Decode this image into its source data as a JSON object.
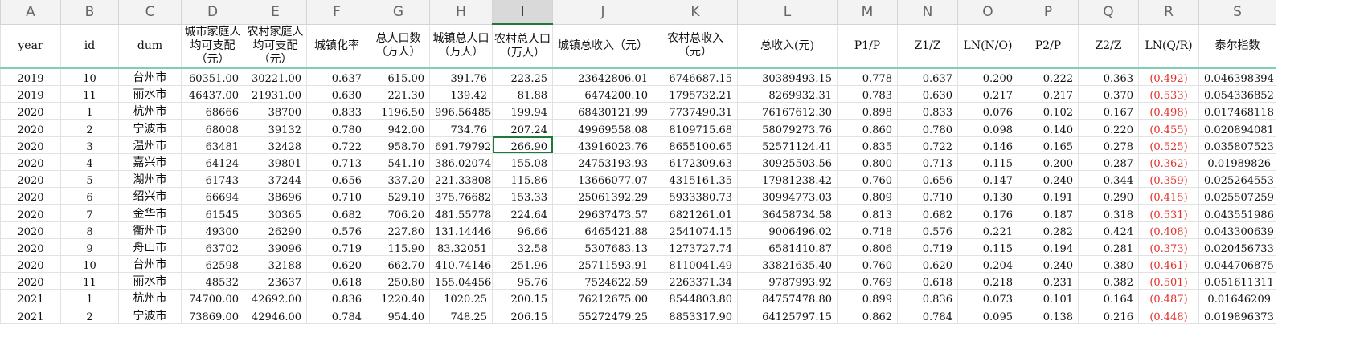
{
  "columns": [
    "A",
    "B",
    "C",
    "D",
    "E",
    "F",
    "G",
    "H",
    "I",
    "J",
    "K",
    "L",
    "M",
    "N",
    "O",
    "P",
    "Q",
    "R",
    "S"
  ],
  "selected_column": "I",
  "headers": [
    "year",
    "id",
    "dum",
    "城市家庭人均可支配（元）",
    "农村家庭人均可支配（元）",
    "城镇化率",
    "总人口数（万人）",
    "城镇总人口（万人）",
    "农村总人口（万人）",
    "城镇总收入（元）",
    "农村总收入（元）",
    "总收入(元)",
    "P1/P",
    "Z1/Z",
    "LN(N/O)",
    "P2/P",
    "Z2/Z",
    "LN(Q/R)",
    "泰尔指数"
  ],
  "rows": [
    [
      "2019",
      "10",
      "台州市",
      "60351.00",
      "30221.00",
      "0.637",
      "615.00",
      "391.76",
      "223.25",
      "23642806.01",
      "6746687.15",
      "30389493.15",
      "0.778",
      "0.637",
      "0.200",
      "0.222",
      "0.363",
      "(0.492)",
      "0.046398394"
    ],
    [
      "2019",
      "11",
      "丽水市",
      "46437.00",
      "21931.00",
      "0.630",
      "221.30",
      "139.42",
      "81.88",
      "6474200.10",
      "1795732.21",
      "8269932.31",
      "0.783",
      "0.630",
      "0.217",
      "0.217",
      "0.370",
      "(0.533)",
      "0.054336852"
    ],
    [
      "2020",
      "1",
      "杭州市",
      "68666",
      "38700",
      "0.833",
      "1196.50",
      "996.56485",
      "199.94",
      "68430121.99",
      "7737490.31",
      "76167612.30",
      "0.898",
      "0.833",
      "0.076",
      "0.102",
      "0.167",
      "(0.498)",
      "0.017468118"
    ],
    [
      "2020",
      "2",
      "宁波市",
      "68008",
      "39132",
      "0.780",
      "942.00",
      "734.76",
      "207.24",
      "49969558.08",
      "8109715.68",
      "58079273.76",
      "0.860",
      "0.780",
      "0.098",
      "0.140",
      "0.220",
      "(0.455)",
      "0.020894081"
    ],
    [
      "2020",
      "3",
      "温州市",
      "63481",
      "32428",
      "0.722",
      "958.70",
      "691.79792",
      "266.90",
      "43916023.76",
      "8655100.65",
      "52571124.41",
      "0.835",
      "0.722",
      "0.146",
      "0.165",
      "0.278",
      "(0.525)",
      "0.035807523"
    ],
    [
      "2020",
      "4",
      "嘉兴市",
      "64124",
      "39801",
      "0.713",
      "541.10",
      "386.02074",
      "155.08",
      "24753193.93",
      "6172309.63",
      "30925503.56",
      "0.800",
      "0.713",
      "0.115",
      "0.200",
      "0.287",
      "(0.362)",
      "0.01989826"
    ],
    [
      "2020",
      "5",
      "湖州市",
      "61743",
      "37244",
      "0.656",
      "337.20",
      "221.33808",
      "115.86",
      "13666077.07",
      "4315161.35",
      "17981238.42",
      "0.760",
      "0.656",
      "0.147",
      "0.240",
      "0.344",
      "(0.359)",
      "0.025264553"
    ],
    [
      "2020",
      "6",
      "绍兴市",
      "66694",
      "38696",
      "0.710",
      "529.10",
      "375.76682",
      "153.33",
      "25061392.29",
      "5933380.73",
      "30994773.03",
      "0.809",
      "0.710",
      "0.130",
      "0.191",
      "0.290",
      "(0.415)",
      "0.025507259"
    ],
    [
      "2020",
      "7",
      "金华市",
      "61545",
      "30365",
      "0.682",
      "706.20",
      "481.55778",
      "224.64",
      "29637473.57",
      "6821261.01",
      "36458734.58",
      "0.813",
      "0.682",
      "0.176",
      "0.187",
      "0.318",
      "(0.531)",
      "0.043551986"
    ],
    [
      "2020",
      "8",
      "衢州市",
      "49300",
      "26290",
      "0.576",
      "227.80",
      "131.14446",
      "96.66",
      "6465421.88",
      "2541074.15",
      "9006496.02",
      "0.718",
      "0.576",
      "0.221",
      "0.282",
      "0.424",
      "(0.408)",
      "0.043300639"
    ],
    [
      "2020",
      "9",
      "舟山市",
      "63702",
      "39096",
      "0.719",
      "115.90",
      "83.32051",
      "32.58",
      "5307683.13",
      "1273727.74",
      "6581410.87",
      "0.806",
      "0.719",
      "0.115",
      "0.194",
      "0.281",
      "(0.373)",
      "0.020456733"
    ],
    [
      "2020",
      "10",
      "台州市",
      "62598",
      "32188",
      "0.620",
      "662.70",
      "410.74146",
      "251.96",
      "25711593.91",
      "8110041.49",
      "33821635.40",
      "0.760",
      "0.620",
      "0.204",
      "0.240",
      "0.380",
      "(0.461)",
      "0.044706875"
    ],
    [
      "2020",
      "11",
      "丽水市",
      "48532",
      "23637",
      "0.618",
      "250.80",
      "155.04456",
      "95.76",
      "7524622.59",
      "2263371.34",
      "9787993.92",
      "0.769",
      "0.618",
      "0.218",
      "0.231",
      "0.382",
      "(0.501)",
      "0.051611311"
    ],
    [
      "2021",
      "1",
      "杭州市",
      "74700.00",
      "42692.00",
      "0.836",
      "1220.40",
      "1020.25",
      "200.15",
      "76212675.00",
      "8544803.80",
      "84757478.80",
      "0.899",
      "0.836",
      "0.073",
      "0.101",
      "0.164",
      "(0.487)",
      "0.01646209"
    ],
    [
      "2021",
      "2",
      "宁波市",
      "73869.00",
      "42946.00",
      "0.784",
      "954.40",
      "748.25",
      "206.15",
      "55272479.25",
      "8853317.90",
      "64125797.15",
      "0.862",
      "0.784",
      "0.095",
      "0.138",
      "0.216",
      "(0.448)",
      "0.019896373"
    ]
  ],
  "active_cell": {
    "row": 4,
    "col": 8
  },
  "colors": {
    "negative": "#e0302a",
    "selection": "#1e7a3c",
    "header_bg": "#f3f3f3"
  }
}
